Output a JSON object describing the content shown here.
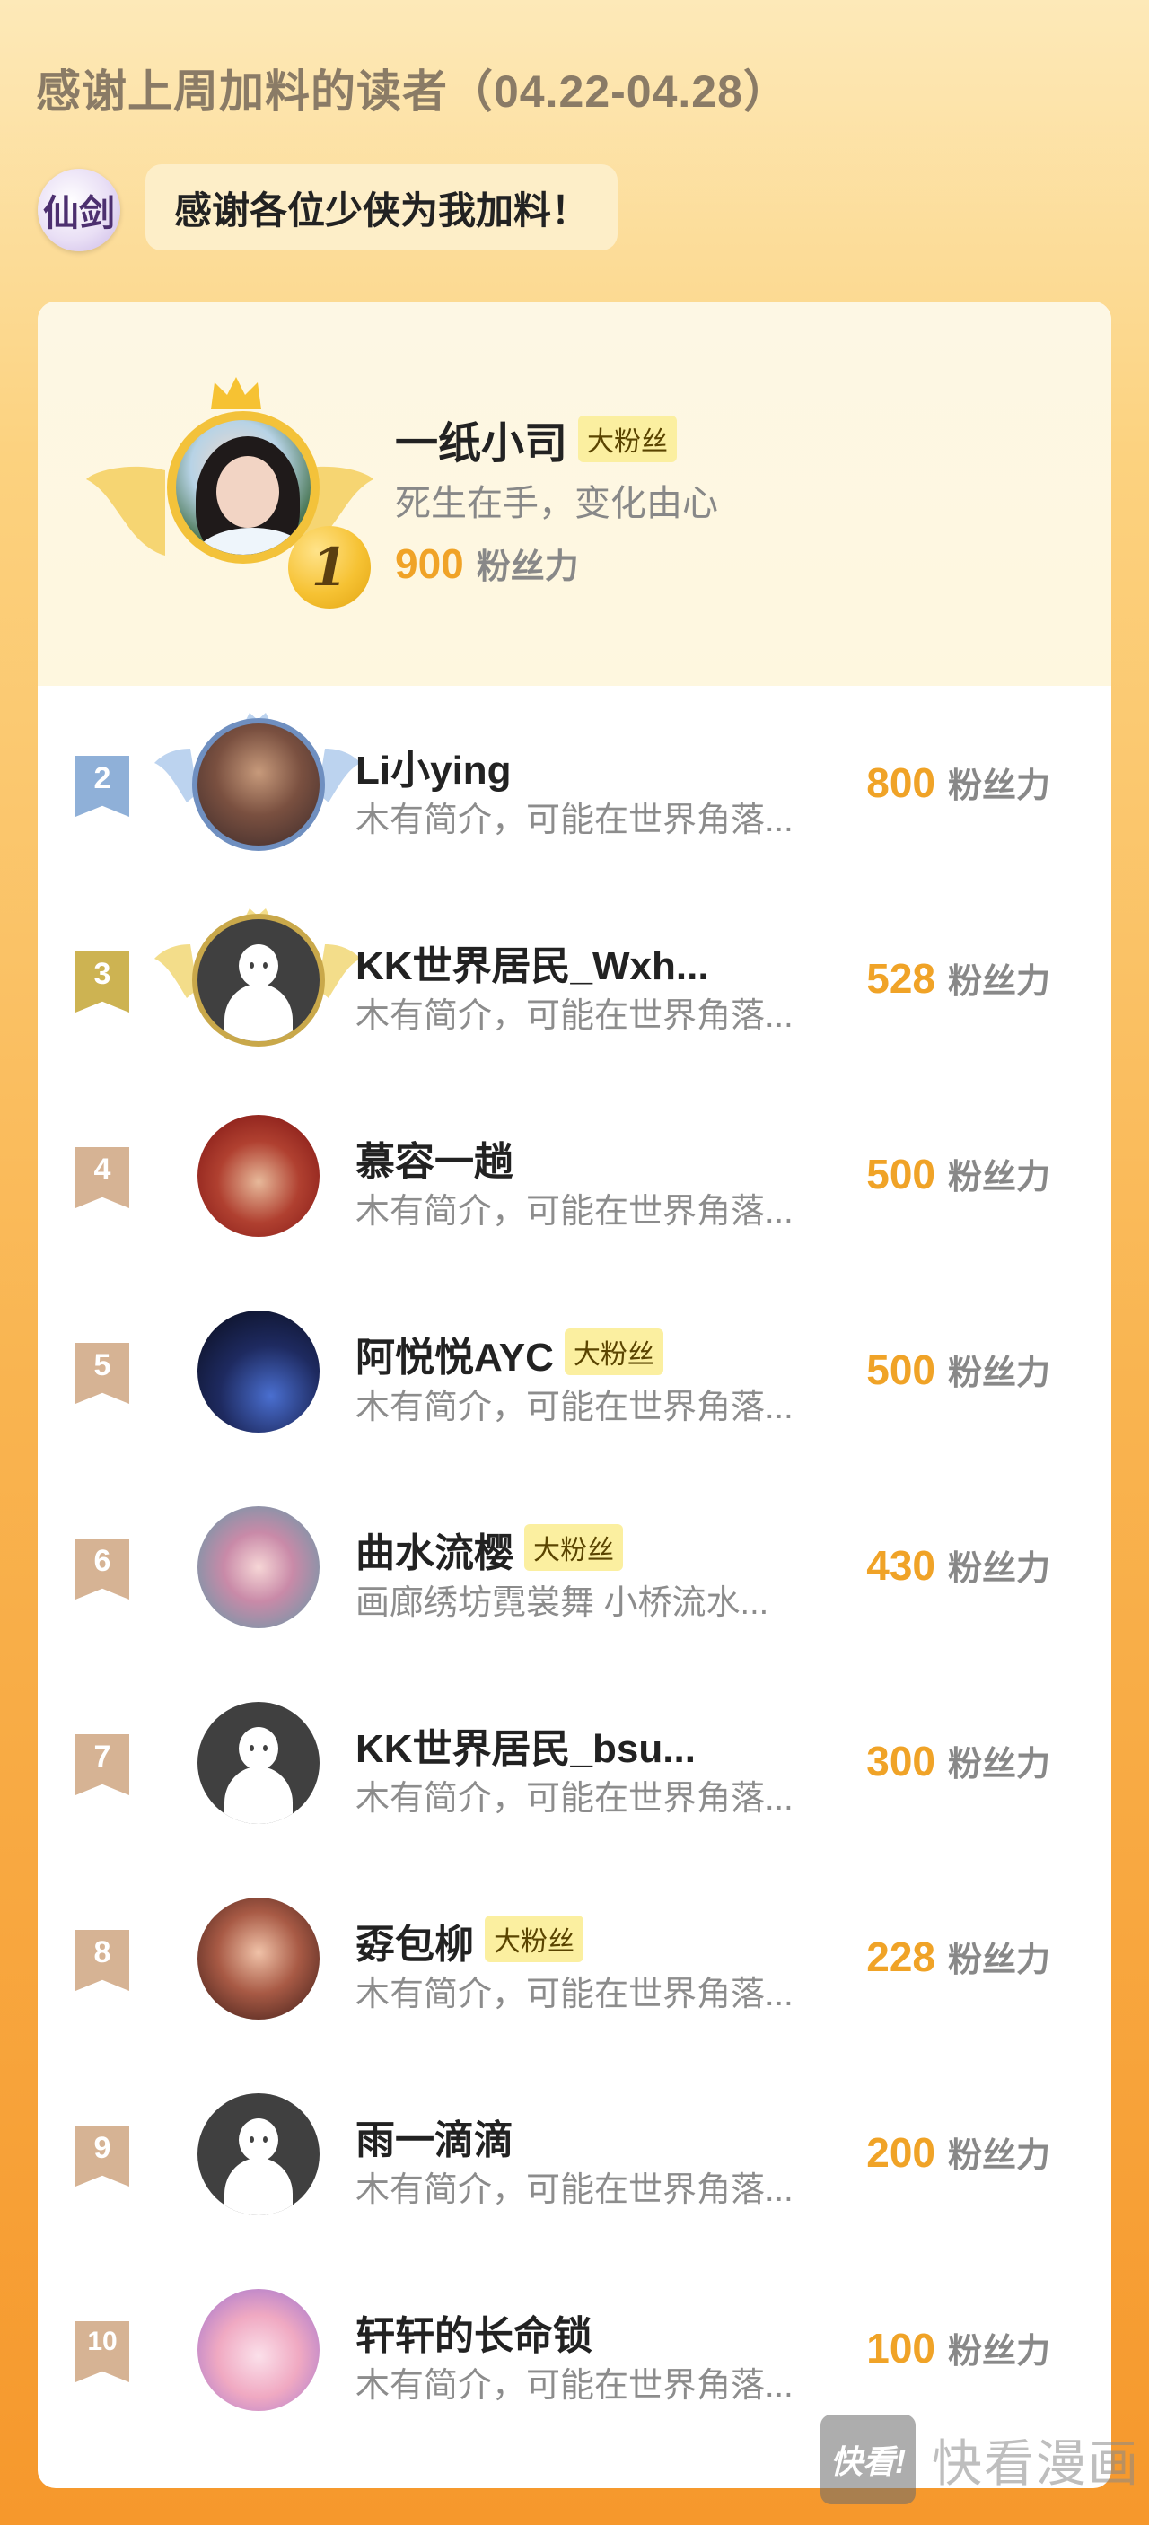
{
  "header": {
    "title": "感谢上周加料的读者（04.22-04.28）",
    "logo_text": "仙剑",
    "message": "感谢各位少侠为我加料！"
  },
  "top_fan": {
    "rank": "1",
    "name": "一纸小司",
    "badge": "大粉丝",
    "motto": "死生在手，变化由心",
    "score": "900",
    "score_unit": "粉丝力"
  },
  "ranking": [
    {
      "rank": "2",
      "name": "Li小ying",
      "badge": "",
      "desc": "木有简介，可能在世界角落...",
      "score": "800",
      "unit": "粉丝力"
    },
    {
      "rank": "3",
      "name": "KK世界居民_Wxh...",
      "badge": "",
      "desc": "木有简介，可能在世界角落...",
      "score": "528",
      "unit": "粉丝力"
    },
    {
      "rank": "4",
      "name": "慕容一趟",
      "badge": "",
      "desc": "木有简介，可能在世界角落...",
      "score": "500",
      "unit": "粉丝力"
    },
    {
      "rank": "5",
      "name": "阿悦悦AYC",
      "badge": "大粉丝",
      "desc": "木有简介，可能在世界角落...",
      "score": "500",
      "unit": "粉丝力"
    },
    {
      "rank": "6",
      "name": "曲水流樱",
      "badge": "大粉丝",
      "desc": "画廊绣坊霓裳舞 小桥流水...",
      "score": "430",
      "unit": "粉丝力"
    },
    {
      "rank": "7",
      "name": "KK世界居民_bsu...",
      "badge": "",
      "desc": "木有简介，可能在世界角落...",
      "score": "300",
      "unit": "粉丝力"
    },
    {
      "rank": "8",
      "name": "孬包柳",
      "badge": "大粉丝",
      "desc": "木有简介，可能在世界角落...",
      "score": "228",
      "unit": "粉丝力"
    },
    {
      "rank": "9",
      "name": "雨一滴滴",
      "badge": "",
      "desc": "木有简介，可能在世界角落...",
      "score": "200",
      "unit": "粉丝力"
    },
    {
      "rank": "10",
      "name": "轩轩的长命锁",
      "badge": "",
      "desc": "木有简介，可能在世界角落...",
      "score": "100",
      "unit": "粉丝力"
    }
  ],
  "watermark": {
    "box_text": "快看!",
    "text": "快看漫画"
  },
  "colors": {
    "score": "#f0a327",
    "rank2_flag": "#8fb0d8",
    "rank3_flag": "#cdb352",
    "rank_other_flag": "#d6b394",
    "badge_bg": "#fbefa0"
  }
}
